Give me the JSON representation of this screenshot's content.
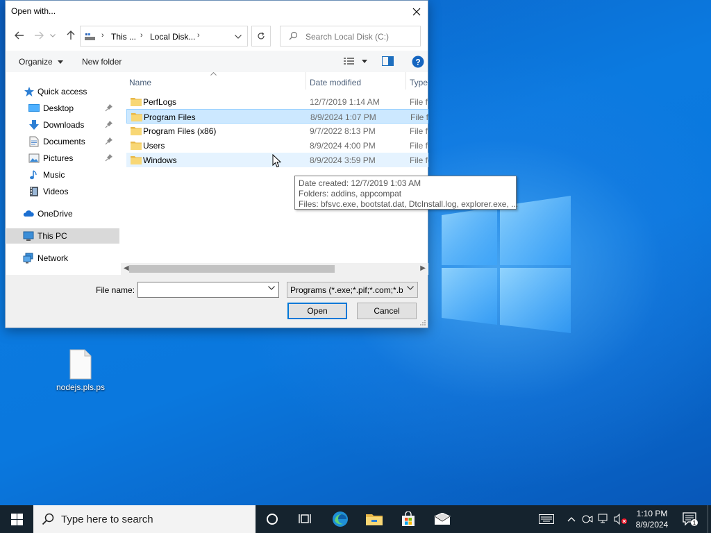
{
  "dialog": {
    "title": "Open with...",
    "address": {
      "crumbs": [
        "This ...",
        "Local Disk..."
      ]
    },
    "search_placeholder": "Search Local Disk (C:)",
    "toolbar": {
      "organize": "Organize",
      "new_folder": "New folder"
    },
    "nav_pane": {
      "quick_access": "Quick access",
      "desktop": "Desktop",
      "downloads": "Downloads",
      "documents": "Documents",
      "pictures": "Pictures",
      "music": "Music",
      "videos": "Videos",
      "onedrive": "OneDrive",
      "this_pc": "This PC",
      "network": "Network"
    },
    "columns": {
      "name": "Name",
      "date_modified": "Date modified",
      "type": "Type"
    },
    "files": [
      {
        "name": "PerfLogs",
        "date": "12/7/2019 1:14 AM",
        "type": "File fo"
      },
      {
        "name": "Program Files",
        "date": "8/9/2024 1:07 PM",
        "type": "File fo"
      },
      {
        "name": "Program Files (x86)",
        "date": "9/7/2022 8:13 PM",
        "type": "File fo"
      },
      {
        "name": "Users",
        "date": "8/9/2024 4:00 PM",
        "type": "File fo"
      },
      {
        "name": "Windows",
        "date": "8/9/2024 3:59 PM",
        "type": "File fo"
      }
    ],
    "tooltip": {
      "line1": "Date created: 12/7/2019 1:03 AM",
      "line2": "Folders: addins, appcompat",
      "line3": "Files: bfsvc.exe, bootstat.dat, DtcInstall.log, explorer.exe, ..."
    },
    "file_name_label": "File name:",
    "file_name_value": "",
    "filter_value": "Programs (*.exe;*.pif;*.com;*.bat;*.cmd)",
    "open_button": "Open",
    "cancel_button": "Cancel"
  },
  "desktop_icons": [
    {
      "label": "nodejs.pls.ps"
    }
  ],
  "taskbar": {
    "search_text": "Type here to search",
    "time": "1:10 PM",
    "date": "8/9/2024",
    "notification_count": "1"
  },
  "colors": {
    "selection": "#cce8ff",
    "selection_border": "#99d1ff",
    "accent": "#0078d7",
    "taskbar": "#15232e"
  }
}
